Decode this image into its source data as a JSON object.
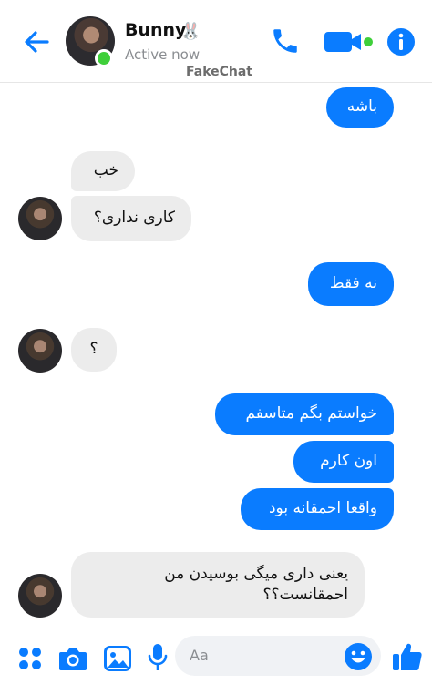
{
  "header": {
    "contact_name": "Bunny",
    "contact_emoji": "🐰",
    "status": "Active now",
    "watermark": "FakeChat",
    "icons": [
      "back-arrow-icon",
      "phone-icon",
      "video-camera-icon",
      "info-icon"
    ]
  },
  "messages": [
    {
      "direction": "outgoing",
      "text": "باشه"
    },
    {
      "direction": "incoming",
      "text": "خب"
    },
    {
      "direction": "incoming",
      "text": "کاری نداری؟"
    },
    {
      "direction": "outgoing",
      "text": "نه فقط"
    },
    {
      "direction": "incoming",
      "text": "؟"
    },
    {
      "direction": "outgoing",
      "text": "خواستم بگم متاسفم"
    },
    {
      "direction": "outgoing",
      "text": "اون کارم"
    },
    {
      "direction": "outgoing",
      "text": "واقعا احمقانه بود"
    },
    {
      "direction": "incoming",
      "text": "یعنی داری میگی بوسیدن من احمقانست؟؟"
    }
  ],
  "composer": {
    "placeholder": "Aa",
    "icons": [
      "apps-grid-icon",
      "camera-icon",
      "gallery-icon",
      "microphone-icon",
      "emoji-icon",
      "like-icon"
    ]
  },
  "colors": {
    "accent": "#0a7cff",
    "incoming_bubble": "#ececec",
    "online": "#3fcf3a"
  }
}
